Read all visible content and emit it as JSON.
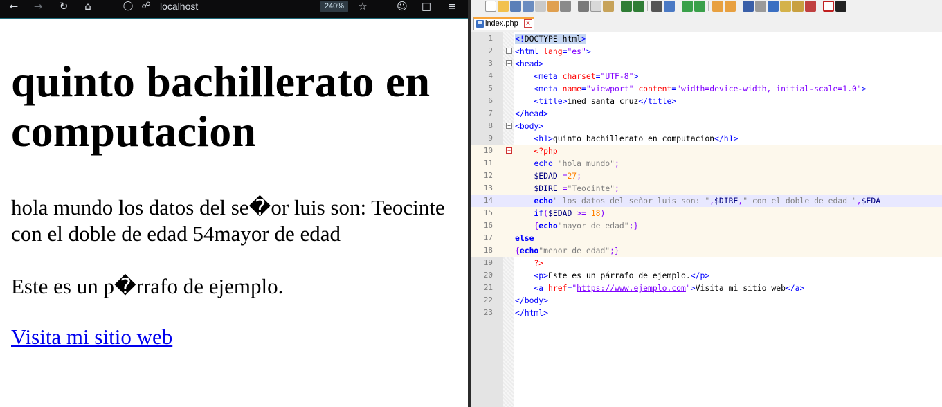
{
  "browser": {
    "url": "localhost",
    "zoom": "240%",
    "page": {
      "heading": "quinto bachillerato en computacion",
      "paragraph1": "hola mundo los datos del se�or luis son: Teocinte con el doble de edad 54mayor de edad",
      "paragraph2": "Este es un p�rrafo de ejemplo.",
      "link_text": "Visita mi sitio web"
    },
    "icons": [
      "back-arrow-icon",
      "forward-arrow-icon",
      "reload-icon",
      "home-icon",
      "shield-icon",
      "lock-icon",
      "star-icon",
      "account-icon",
      "extensions-icon",
      "menu-icon"
    ]
  },
  "editor": {
    "tab": {
      "label": "index.php"
    },
    "colors": {
      "tag": "#0000ff",
      "attribute": "#ff0000",
      "string": "#8000ff",
      "php_string": "#808080",
      "number": "#ff8000"
    },
    "line_numbers": [
      "1",
      "2",
      "3",
      "4",
      "5",
      "6",
      "7",
      "8",
      "9",
      "10",
      "11",
      "12",
      "13",
      "14",
      "15",
      "16",
      "17",
      "18",
      "19",
      "20",
      "21",
      "22",
      "23"
    ],
    "code": {
      "l1": {
        "a": "<!",
        "b": "DOCTYPE html",
        "c": ">"
      },
      "l2": {
        "a": "<html",
        "b": " lang",
        "c": "=",
        "d": "\"es\"",
        "e": ">"
      },
      "l3": {
        "a": "<head>"
      },
      "l4": {
        "ind": "    ",
        "a": "<meta",
        "b": " charset",
        "c": "=",
        "d": "\"UTF-8\"",
        "e": ">"
      },
      "l5": {
        "ind": "    ",
        "a": "<meta",
        "b": " name",
        "c": "=",
        "d": "\"viewport\"",
        "e": " content",
        "f": "=",
        "g": "\"width=device-width, initial-scale=1.0\"",
        "h": ">"
      },
      "l6": {
        "ind": "    ",
        "a": "<title>",
        "b": "ined santa cruz",
        "c": "</title>"
      },
      "l7": {
        "a": "</head>"
      },
      "l8": {
        "a": "<body>"
      },
      "l9": {
        "ind": "    ",
        "a": "<h1>",
        "b": "quinto bachillerato en computacion",
        "c": "</h1>"
      },
      "l10": {
        "ind": "    ",
        "a": "<?php"
      },
      "l11": {
        "ind": "    ",
        "a": "echo",
        "b": " \"hola mundo\"",
        "c": ";"
      },
      "l12": {
        "ind": "    ",
        "a": "$EDAD",
        "b": " =",
        "c": "27",
        "d": ";"
      },
      "l13": {
        "ind": "    ",
        "a": "$DIRE",
        "b": " =",
        "c": "\"Teocinte\"",
        "d": ";"
      },
      "l14": {
        "ind": "    ",
        "a": "echo",
        "b": "\" los datos del señor luis son: \"",
        "c": ",",
        "d": "$DIRE",
        "e": ",",
        "f": "\" con el doble de edad \"",
        "g": ",",
        "h": "$EDA"
      },
      "l15": {
        "ind": "    ",
        "a": "if",
        "b": "(",
        "c": "$EDAD",
        "d": " >= ",
        "e": "18",
        "f": ")"
      },
      "l16": {
        "ind": "    ",
        "a": "{",
        "b": "echo",
        "c": "\"mayor de edad\"",
        "d": ";}"
      },
      "l17": {
        "a": "else"
      },
      "l18": {
        "a": "{",
        "b": "echo",
        "c": "\"menor de edad\"",
        "d": ";}"
      },
      "l19": {
        "ind": "    ",
        "a": "?>"
      },
      "l20": {
        "ind": "    ",
        "a": "<p>",
        "b": "Este es un párrafo de ejemplo.",
        "c": "</p>"
      },
      "l21": {
        "ind": "    ",
        "a": "<a",
        "b": " href",
        "c": "=",
        "d": "\"",
        "e": "https://www.ejemplo.com",
        "f": "\"",
        "g": ">",
        "h": "Visita mi sitio web",
        "i": "</a>"
      },
      "l22": {
        "a": "</body>"
      },
      "l23": {
        "a": "</html>"
      }
    }
  }
}
